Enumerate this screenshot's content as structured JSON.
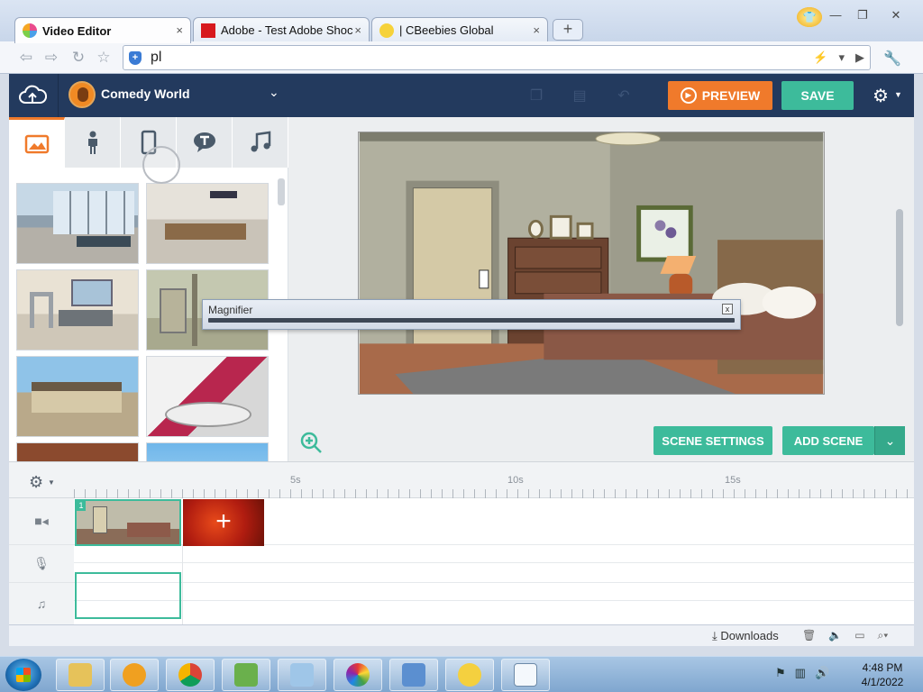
{
  "browser": {
    "tabs": [
      {
        "label": "Video Editor",
        "active": true
      },
      {
        "label": "Adobe - Test Adobe Shoc",
        "active": false
      },
      {
        "label": "| CBeebies Global",
        "active": false
      }
    ],
    "new_tab_label": "+",
    "close_glyph": "×",
    "address": "pl",
    "window_controls": {
      "minimize": "—",
      "restore": "❐",
      "close": "✕"
    }
  },
  "header": {
    "world_name": "Comedy World",
    "preview_label": "PREVIEW",
    "save_label": "SAVE",
    "colors": {
      "header_bg": "#233a5e",
      "preview": "#f07a2b",
      "save": "#3dbb9b"
    }
  },
  "library": {
    "tabs": [
      {
        "icon": "image-icon",
        "active": true
      },
      {
        "icon": "character-icon",
        "active": false
      },
      {
        "icon": "prop-phone-icon",
        "active": false
      },
      {
        "icon": "text-bubble-icon",
        "active": false
      },
      {
        "icon": "music-icon",
        "active": false
      }
    ],
    "thumbnails": [
      "airport-lounge",
      "airport-checkin",
      "airport-security",
      "industrial-room",
      "house-exterior",
      "stage-spotlights",
      "brick-wall",
      "blue-sky"
    ]
  },
  "stage": {
    "scene_settings_label": "SCENE SETTINGS",
    "add_scene_label": "ADD SCENE",
    "zoom_icon": "zoom-in-icon"
  },
  "timeline": {
    "ruler_labels": [
      "5s",
      "10s",
      "15s"
    ],
    "tracks": [
      "video-track",
      "voice-track",
      "music-track"
    ],
    "clip_number": "1",
    "add_glyph": "+"
  },
  "magnifier": {
    "title": "Magnifier",
    "close_glyph": "x"
  },
  "statusbar": {
    "downloads_label": "Downloads"
  },
  "taskbar": {
    "time": "4:48 PM",
    "date": "4/1/2022"
  }
}
